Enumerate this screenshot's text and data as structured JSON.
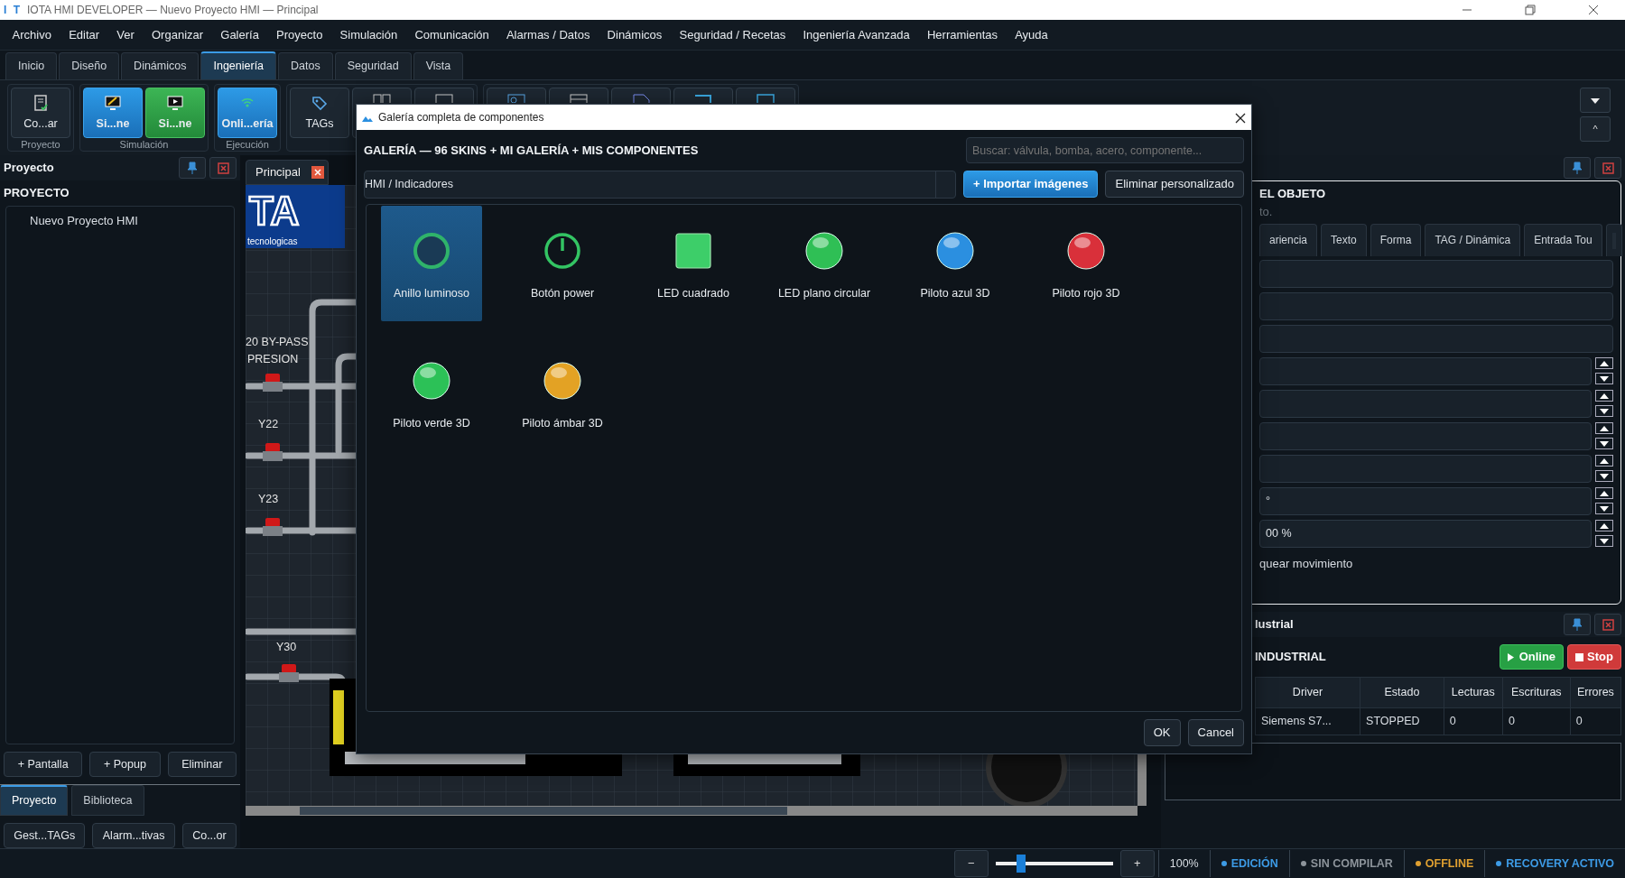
{
  "window": {
    "logo": "I T",
    "title": "IOTA HMI DEVELOPER — Nuevo Proyecto HMI — Principal"
  },
  "menu": [
    "Archivo",
    "Editar",
    "Ver",
    "Organizar",
    "Galería",
    "Proyecto",
    "Simulación",
    "Comunicación",
    "Alarmas / Datos",
    "Dinámicos",
    "Seguridad / Recetas",
    "Ingeniería Avanzada",
    "Herramientas",
    "Ayuda"
  ],
  "ribbon_tabs": [
    {
      "label": "Inicio",
      "selected": false
    },
    {
      "label": "Diseño",
      "selected": false
    },
    {
      "label": "Dinámicos",
      "selected": false
    },
    {
      "label": "Ingeniería",
      "selected": true
    },
    {
      "label": "Datos",
      "selected": false
    },
    {
      "label": "Seguridad",
      "selected": false
    },
    {
      "label": "Vista",
      "selected": false
    }
  ],
  "ribbon_groups": [
    {
      "label": "Proyecto",
      "buttons": [
        {
          "label": "Co...ar",
          "kind": "plain"
        }
      ]
    },
    {
      "label": "Simulación",
      "buttons": [
        {
          "label": "Si...ne",
          "kind": "blue"
        },
        {
          "label": "Si...ne",
          "kind": "green"
        }
      ]
    },
    {
      "label": "Ejecución",
      "buttons": [
        {
          "label": "Onli...ería",
          "kind": "blue"
        }
      ]
    },
    {
      "buttons": [
        {
          "label": "TAGs",
          "kind": "plain"
        },
        {
          "kind": "plain"
        },
        {
          "kind": "plain"
        }
      ]
    },
    {
      "buttons": [
        {
          "kind": "plain"
        },
        {
          "kind": "plain"
        },
        {
          "kind": "plain"
        },
        {
          "kind": "plain"
        },
        {
          "kind": "plain"
        }
      ]
    }
  ],
  "ribbon_controls": {
    "collapse": "^"
  },
  "left_panel": {
    "title": "Proyecto",
    "heading": "PROYECTO",
    "tree": [
      {
        "label": "Nuevo Proyecto HMI"
      }
    ],
    "buttons": [
      "+ Pantalla",
      "+ Popup",
      "Eliminar"
    ],
    "tabs": [
      {
        "label": "Proyecto",
        "selected": true
      },
      {
        "label": "Biblioteca",
        "selected": false
      }
    ],
    "tools": [
      "Gest...TAGs",
      "Alarm...tivas",
      "Co...or"
    ]
  },
  "document_tab": {
    "label": "Principal"
  },
  "canvas": {
    "logo": "TA",
    "logo_caption": "tecnologicas",
    "labels": [
      "20 BY-PASS",
      "PRESION",
      "Y22",
      "Y23",
      "Y30"
    ]
  },
  "dialog": {
    "title": "Galería completa de componentes",
    "heading": "GALERÍA — 96 SKINS + MI GALERÍA + MIS COMPONENTES",
    "search": {
      "placeholder": "Buscar: válvula, bomba, acero, componente..."
    },
    "category": "HMI / Indicadores",
    "buttons": [
      {
        "label": "+ Importar imágenes",
        "kind": "primary"
      },
      {
        "label": "Eliminar personalizado",
        "kind": "secondary"
      }
    ],
    "items": [
      {
        "label": "Anillo luminoso",
        "kind": "ring",
        "color": "#2fb36a",
        "selected": true
      },
      {
        "label": "Botón power",
        "kind": "power",
        "color": "#33c463",
        "selected": false
      },
      {
        "label": "LED cuadrado",
        "kind": "square",
        "color": "#3dce69",
        "selected": false
      },
      {
        "label": "LED plano circular",
        "kind": "sphere",
        "color": "#2fbf55",
        "selected": false
      },
      {
        "label": "Piloto azul 3D",
        "kind": "sphere",
        "color": "#2b8fe0",
        "selected": false
      },
      {
        "label": "Piloto rojo 3D",
        "kind": "sphere",
        "color": "#d9303a",
        "selected": false
      },
      {
        "label": "Piloto verde 3D",
        "kind": "sphere",
        "color": "#2cc157",
        "selected": false
      },
      {
        "label": "Piloto ámbar 3D",
        "kind": "sphere",
        "color": "#e3a224",
        "selected": false
      }
    ],
    "actions": [
      "OK",
      "Cancel"
    ]
  },
  "properties_panel": {
    "heading": "EL OBJETO",
    "note": "to.",
    "tabs": [
      {
        "label": "ariencia",
        "selected": false
      },
      {
        "label": "Texto",
        "selected": false
      },
      {
        "label": "Forma",
        "selected": false
      },
      {
        "label": "TAG / Dinámica",
        "selected": false
      },
      {
        "label": "Entrada Tou",
        "selected": false
      }
    ],
    "fields": [
      {
        "kind": "text"
      },
      {
        "kind": "text"
      },
      {
        "kind": "text"
      },
      {
        "kind": "spin"
      },
      {
        "kind": "spin"
      },
      {
        "kind": "spin"
      },
      {
        "kind": "spin"
      },
      {
        "kind": "spin",
        "value": "°"
      },
      {
        "kind": "spin",
        "value": "00 %"
      }
    ],
    "option": "quear movimiento"
  },
  "comm_panel": {
    "title": "lustrial",
    "heading": "INDUSTRIAL",
    "buttons": [
      {
        "label": "Online",
        "kind": "success"
      },
      {
        "label": "Stop",
        "kind": "danger"
      }
    ],
    "table": {
      "columns": [
        "Driver",
        "Estado",
        "Lecturas",
        "Escrituras",
        "Errores"
      ],
      "rows": [
        [
          "Siemens S7...",
          "STOPPED",
          "0",
          "0",
          "0"
        ]
      ]
    }
  },
  "status_bar": {
    "zoom_out": "−",
    "zoom_in": "+",
    "zoom": {
      "level": 0.22
    },
    "zoom_text": "100%",
    "states": [
      {
        "label": "EDICIÓN",
        "color": "#3d9be6"
      },
      {
        "label": "SIN COMPILAR",
        "color": "#8d949b"
      },
      {
        "label": "OFFLINE",
        "color": "#e0a030"
      },
      {
        "label": "RECOVERY ACTIVO",
        "color": "#3d9be6"
      }
    ]
  }
}
